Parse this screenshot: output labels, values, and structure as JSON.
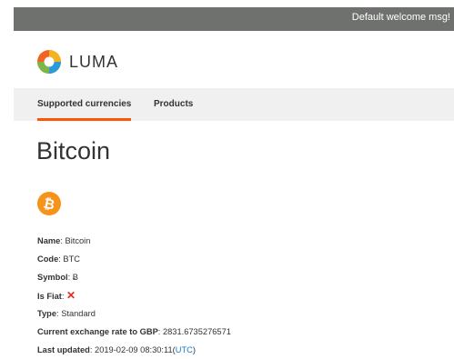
{
  "header": {
    "welcome": "Default welcome msg!"
  },
  "logo": {
    "name": "LUMA",
    "icon": "luma-logo-icon"
  },
  "nav": {
    "items": [
      {
        "label": "Supported currencies",
        "active": true
      },
      {
        "label": "Products",
        "active": false
      }
    ]
  },
  "page": {
    "title": "Bitcoin"
  },
  "currency": {
    "icon": "bitcoin-icon",
    "name_label": "Name",
    "name": "Bitcoin",
    "code_label": "Code",
    "code": "BTC",
    "symbol_label": "Symbol",
    "symbol": "Ƀ",
    "is_fiat_label": "Is Fiat",
    "is_fiat_icon": "cross-icon",
    "type_label": "Type",
    "type": "Standard",
    "rate_label": "Current exchange rate to GBP",
    "rate": "2831.6735276571",
    "updated_label": "Last updated",
    "updated": "2019-02-09 08:30:11",
    "timezone": "UTC"
  },
  "colors": {
    "accent": "#ff5501",
    "topbar": "#6e716e",
    "bitcoin": "#f7931a",
    "cross": "#e02b27",
    "link": "#1979c3"
  }
}
